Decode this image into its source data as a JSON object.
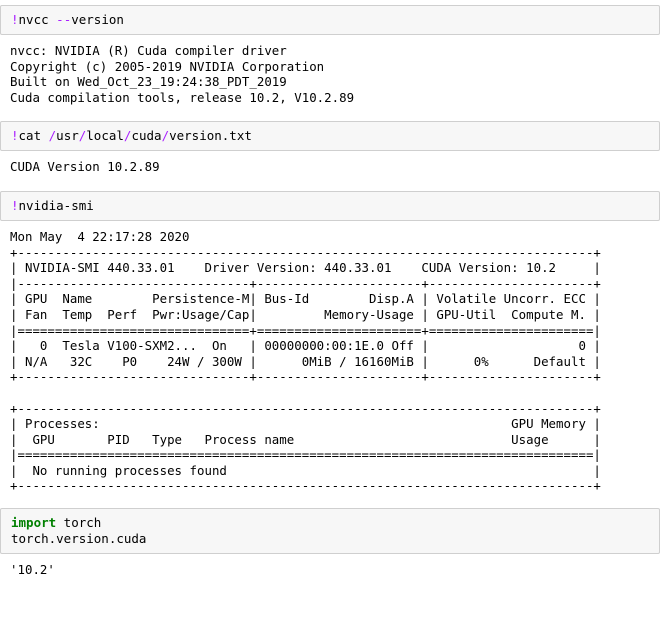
{
  "notebook": {
    "cells": [
      {
        "type": "code",
        "name": "nvcc-version-cell",
        "source_prefix": "!",
        "source_cmd": "nvcc ",
        "source_flag": "--",
        "source_tail": "version",
        "full_source": "!nvcc --version",
        "output": [
          "nvcc: NVIDIA (R) Cuda compiler driver",
          "Copyright (c) 2005-2019 NVIDIA Corporation",
          "Built on Wed_Oct_23_19:24:38_PDT_2019",
          "Cuda compilation tools, release 10.2, V10.2.89"
        ]
      },
      {
        "type": "code",
        "name": "cat-version-cell",
        "full_source": "!cat /usr/local/cuda/version.txt",
        "output": [
          "CUDA Version 10.2.89"
        ]
      },
      {
        "type": "code",
        "name": "nvidia-smi-cell",
        "full_source": "!nvidia-smi",
        "output": [
          "Mon May  4 22:17:28 2020       ",
          "+-----------------------------------------------------------------------------+",
          "| NVIDIA-SMI 440.33.01    Driver Version: 440.33.01    CUDA Version: 10.2     |",
          "|-------------------------------+----------------------+----------------------+",
          "| GPU  Name        Persistence-M| Bus-Id        Disp.A | Volatile Uncorr. ECC |",
          "| Fan  Temp  Perf  Pwr:Usage/Cap|         Memory-Usage | GPU-Util  Compute M. |",
          "|===============================+======================+======================|",
          "|   0  Tesla V100-SXM2...  On   | 00000000:00:1E.0 Off |                    0 |",
          "| N/A   32C    P0    24W / 300W |      0MiB / 16160MiB |      0%      Default |",
          "+-------------------------------+----------------------+----------------------+",
          "                                                                               ",
          "+-----------------------------------------------------------------------------+",
          "| Processes:                                                       GPU Memory |",
          "|  GPU       PID   Type   Process name                             Usage      |",
          "|=============================================================================|",
          "|  No running processes found                                                 |",
          "+-----------------------------------------------------------------------------+"
        ]
      },
      {
        "type": "code",
        "name": "torch-version-cell",
        "source_keyword": "import",
        "source_rest": " torch",
        "source_line2": "torch.version.cuda",
        "output": [
          "'10.2'"
        ]
      }
    ]
  },
  "colors": {
    "operator_purple": "#aa22ff",
    "keyword_green": "#008000",
    "cell_background": "#f7f7f7",
    "cell_border": "#cfcfcf",
    "text": "#000000",
    "page_background": "#ffffff"
  },
  "gpu_info": {
    "nvidia_smi_version": "440.33.01",
    "driver_version": "440.33.01",
    "cuda_version": "10.2",
    "timestamp": "Mon May  4 22:17:28 2020",
    "gpu_index": "0",
    "gpu_name": "Tesla V100-SXM2...",
    "persistence_mode": "On",
    "bus_id": "00000000:00:1E.0",
    "disp_a": "Off",
    "uncorr_ecc": "0",
    "fan": "N/A",
    "temp": "32C",
    "perf": "P0",
    "power_usage": "24W",
    "power_cap": "300W",
    "memory_used": "0MiB",
    "memory_total": "16160MiB",
    "gpu_util": "0%",
    "compute_mode": "Default",
    "processes": "No running processes found"
  },
  "cuda_toolkit": {
    "nvcc_driver_line": "nvcc: NVIDIA (R) Cuda compiler driver",
    "copyright": "Copyright (c) 2005-2019 NVIDIA Corporation",
    "build_date": "Built on Wed_Oct_23_19:24:38_PDT_2019",
    "release": "Cuda compilation tools, release 10.2, V10.2.89",
    "version_txt": "CUDA Version 10.2.89",
    "torch_cuda": "'10.2'"
  }
}
